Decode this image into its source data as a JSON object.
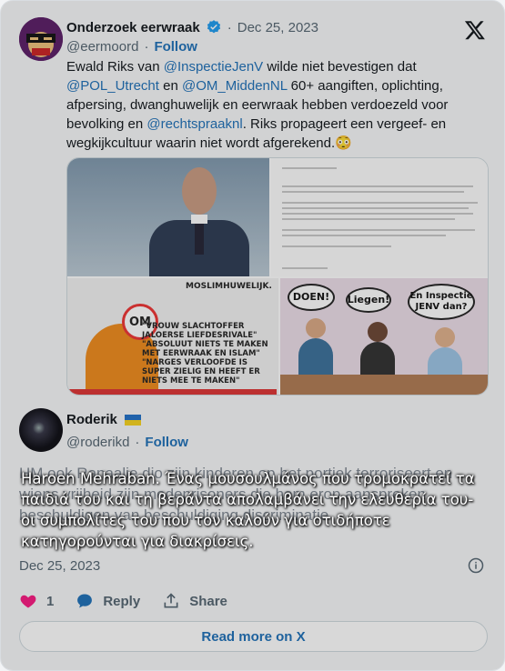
{
  "tweet": {
    "author_name": "Onderzoek eerwraak",
    "author_handle": "@eermoord",
    "separator": "·",
    "date": "Dec 25, 2023",
    "follow_label": "Follow",
    "text_parts": [
      {
        "t": "Ewald Riks van ",
        "m": false
      },
      {
        "t": "@InspectieJenV",
        "m": true
      },
      {
        "t": " wilde niet bevestigen dat ",
        "m": false
      },
      {
        "t": "@POL_Utrecht",
        "m": true
      },
      {
        "t": " en ",
        "m": false
      },
      {
        "t": "@OM_MiddenNL",
        "m": true
      },
      {
        "t": " 60+ aangiften, oplichting, afpersing, dwanghuwelijk en eerwraak hebben verdoezeld voor bevolking en ",
        "m": false
      },
      {
        "t": "@rechtspraaknl",
        "m": true
      },
      {
        "t": ". Riks propageert een vergeef- en wegkijkcultuur waarin niet wordt afgerekend.😳",
        "m": false
      }
    ],
    "media": {
      "meme_title": "MOSLIMHUWELIJK.",
      "meme_quote": "\"VROUW SLACHTOFFER JALOERSE LIEFDESRIVALE\" \"ABSOLUUT NIETS TE MAKEN MET EERWRAAK EN ISLAM\" \"NARGES VERLOOFDE IS SUPER ZIELIG EN HEEFT ER NIETS MEE TE MAKEN\"",
      "om_logo": "OM",
      "bubble_1": "DOEN!",
      "bubble_2": "Liegen!",
      "bubble_3": "En Inspectie JENV dan?"
    }
  },
  "reply": {
    "author_name": "Roderik",
    "author_handle": "@roderikd",
    "follow_label": "Follow",
    "text": "HM ook Ranaalie dio zijn kinderen op het portiek terroriseert en wiens vrijheid zijn medeprisoners die hem erop aanspreken beschuldigen van beschuldiging discriminatie",
    "date": "Dec 25, 2023",
    "likes": "1",
    "reply_label": "Reply",
    "share_label": "Share",
    "read_more_label": "Read more on X"
  },
  "caption": {
    "text": "Haroen Mehraban. Ένας μουσουλμάνος που τρομοκρατεί τα παιδιά του και τη βεράντα απολαμβάνει την ελευθερία του- οι συμπολίτες του που τον καλούν για οτιδήποτε κατηγορούνται για διακρίσεις."
  },
  "colors": {
    "link": "#1d6fb8",
    "verified": "#1d9bf0",
    "like": "#f91880"
  },
  "icons": [
    "verified-badge-icon",
    "x-logo-icon",
    "info-icon",
    "heart-icon",
    "reply-bubble-icon",
    "share-icon"
  ]
}
